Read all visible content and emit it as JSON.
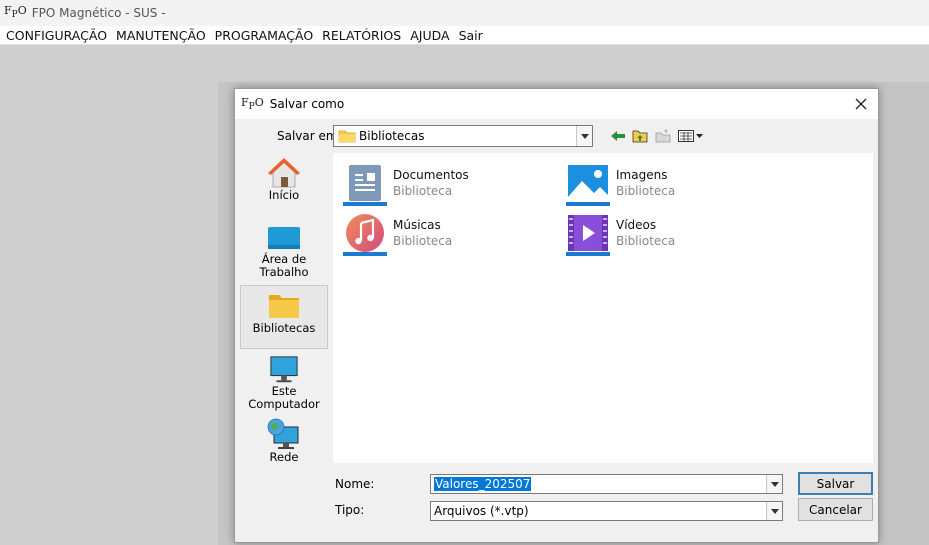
{
  "app": {
    "logo": "FPO",
    "title": "FPO Magnético - SUS -"
  },
  "menu": [
    {
      "label": "CONFIGURAÇÃO"
    },
    {
      "label": "MANUTENÇÃO"
    },
    {
      "label": "PROGRAMAÇÃO"
    },
    {
      "label": "RELATÓRIOS"
    },
    {
      "label": "AJUDA"
    },
    {
      "label": "Sair"
    }
  ],
  "dialog": {
    "logo": "FPO",
    "title": "Salvar como",
    "save_in_label": "Salvar em:",
    "save_in_value": "Bibliotecas",
    "places": [
      {
        "label": "Início",
        "icon": "home-icon"
      },
      {
        "label": "Área de Trabalho",
        "icon": "desktop-icon"
      },
      {
        "label": "Bibliotecas",
        "icon": "folder-icon"
      },
      {
        "label": "Este Computador",
        "icon": "monitor-icon"
      },
      {
        "label": "Rede",
        "icon": "network-icon"
      }
    ],
    "libraries": [
      {
        "name": "Documentos",
        "type": "Biblioteca",
        "icon": "documents-icon"
      },
      {
        "name": "Imagens",
        "type": "Biblioteca",
        "icon": "pictures-icon"
      },
      {
        "name": "Músicas",
        "type": "Biblioteca",
        "icon": "music-icon"
      },
      {
        "name": "Vídeos",
        "type": "Biblioteca",
        "icon": "videos-icon"
      }
    ],
    "name_label": "Nome:",
    "name_value": "Valores_202507",
    "type_label": "Tipo:",
    "type_value": "Arquivos (*.vtp)",
    "save_button": "Salvar",
    "cancel_button": "Cancelar"
  },
  "colors": {
    "accent": "#0078d7",
    "folder": "#f7c948",
    "desktop_blue": "#1e9bd7"
  }
}
